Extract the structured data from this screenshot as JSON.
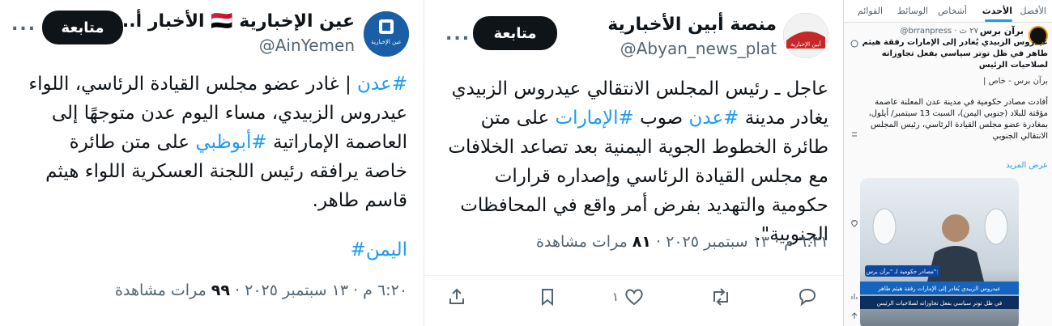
{
  "tweet1": {
    "name": "عين الإخبارية 🇾🇪 الأخبار أ...",
    "handle": "@AinYemen",
    "follow_label": "متابعة",
    "more_label": "...",
    "avatar_text": "عين الإخبارية",
    "text_tag1": "#عدن",
    "text_part1": " | غادر عضو مجلس القيادة الرئاسي، اللواء عيدروس الزبيدي، مساء اليوم عدن متوجهًا إلى العاصمة الإماراتية ",
    "text_tag2": "#أبوظبي",
    "text_part2": " على متن طائرة خاصة يرافقه رئيس اللجنة العسكرية اللواء هيثم قاسم طاهر.",
    "tag_line": "#اليمن",
    "meta_time": "٦:٢٠ م · ١٣ سبتمبر ٢٠٢٥ · ",
    "meta_views": "٩٩",
    "meta_views_label": " مرات مشاهدة"
  },
  "tweet2": {
    "name": "منصة أبين الأخبارية",
    "handle": "@Abyan_news_plat",
    "follow_label": "متابعة",
    "more_label": "...",
    "avatar_text": "أبين الإخبارية",
    "text_part1": "عاجل ـ رئيس المجلس الانتقالي عيدروس الزبيدي يغادر مدينة ",
    "text_tag1": "#عدن",
    "text_part2": " صوب ",
    "text_tag2": "#الإمارات",
    "text_part3": " على متن طائرة الخطوط الجوية اليمنية بعد تصاعد الخلافات مع مجلس القيادة الرئاسي وإصداره قرارات حكومية والتهديد بفرض أمر واقع في المحافظات الجنوبية\".",
    "meta_time": "٦:٣١ م · ١٣ سبتمبر ٢٠٢٥ · ",
    "meta_views": "٨١",
    "meta_views_label": " مرات مشاهدة",
    "like_count": "١"
  },
  "panel3": {
    "tabs": [
      "الأفضل",
      "الأحدث",
      "أشخاص",
      "الوسائط",
      "القوائم"
    ],
    "active_tab": "الأحدث",
    "name": "برآن برس",
    "handle": "@brranpress · ٢٧ ث",
    "text1": "عيدروس الزبيدي يُغادر إلى الإمارات رفقة هيثم طاهر في ظل توتر سياسي بفعل تجاوزاته لصلاحيات الرئيس",
    "text2": "برآن برس - خاص |",
    "text3": "أفادت مصادر حكومية في مدينة عدن المعلنة عاصمة مؤقتة للبلاد (جنوبي اليمن)، السبت 13 سبتمبر/ أيلول، بمغادرة عضو مجلس القيادة الرئاسي، رئيس المجلس الانتقالي الجنوبي",
    "show_more": "عرض المزيد",
    "image_badge": "مصادر حكومية لـ \"برآن برس\":",
    "image_caption1": "عيدروس الزبيدي يُغادر إلى الإمارات رفقة هيثم طاهر",
    "image_caption2": "في ظل توتر سياسي بفعل تجاوزاته لصلاحيات الرئيس"
  },
  "colors": {
    "link": "#1d9bf0",
    "text": "#0f1419",
    "muted": "#536471"
  }
}
